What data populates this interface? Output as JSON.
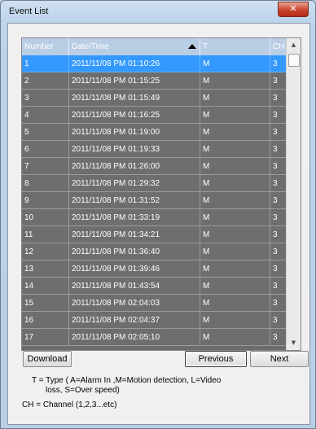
{
  "window": {
    "title": "Event List",
    "close_glyph": "✕"
  },
  "table": {
    "columns": [
      "Number",
      "Date/Time",
      "T",
      "CH"
    ],
    "rows": [
      [
        "1",
        "2011/11/08 PM 01:10:26",
        "M",
        "3"
      ],
      [
        "2",
        "2011/11/08 PM 01:15:25",
        "M",
        "3"
      ],
      [
        "3",
        "2011/11/08 PM 01:15:49",
        "M",
        "3"
      ],
      [
        "4",
        "2011/11/08 PM 01:16:25",
        "M",
        "3"
      ],
      [
        "5",
        "2011/11/08 PM 01:19:00",
        "M",
        "3"
      ],
      [
        "6",
        "2011/11/08 PM 01:19:33",
        "M",
        "3"
      ],
      [
        "7",
        "2011/11/08 PM 01:26:00",
        "M",
        "3"
      ],
      [
        "8",
        "2011/11/08 PM 01:29:32",
        "M",
        "3"
      ],
      [
        "9",
        "2011/11/08 PM 01:31:52",
        "M",
        "3"
      ],
      [
        "10",
        "2011/11/08 PM 01:33:19",
        "M",
        "3"
      ],
      [
        "11",
        "2011/11/08 PM 01:34:21",
        "M",
        "3"
      ],
      [
        "12",
        "2011/11/08 PM 01:36:40",
        "M",
        "3"
      ],
      [
        "13",
        "2011/11/08 PM 01:39:46",
        "M",
        "3"
      ],
      [
        "14",
        "2011/11/08 PM 01:43:54",
        "M",
        "3"
      ],
      [
        "15",
        "2011/11/08 PM 02:04:03",
        "M",
        "3"
      ],
      [
        "16",
        "2011/11/08 PM 02:04:37",
        "M",
        "3"
      ],
      [
        "17",
        "2011/11/08 PM 02:05:10",
        "M",
        "3"
      ]
    ],
    "selected_index": 0,
    "sort_column": "Date/Time"
  },
  "buttons": {
    "download": "Download",
    "previous": "Previous",
    "next": "Next"
  },
  "notes": {
    "type_line1": "T = Type ( A=Alarm In ,M=Motion detection, L=Video",
    "type_line2": "loss, S=Over speed)",
    "channel": "CH = Channel (1,2,3...etc)"
  },
  "colors": {
    "row_bg": "#6e6e6e",
    "selected_bg": "#3399ff",
    "header_bg": "#b9cde5"
  }
}
